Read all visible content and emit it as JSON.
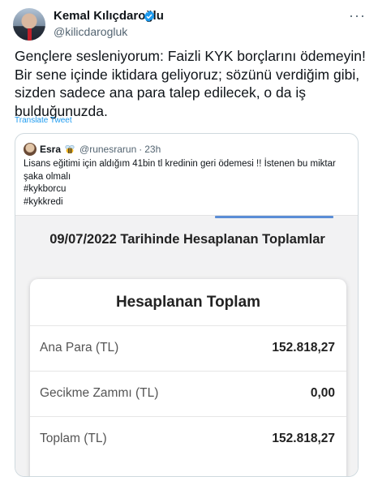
{
  "tweet": {
    "author_name": "Kemal Kılıçdaroğlu",
    "author_handle": "@kilicdarogluk",
    "text": "Gençlere sesleniyorum: Faizli KYK borçlarını ödemeyin! Bir sene içinde iktidara geliyoruz; sözünü verdiğim gibi, sizden sadece ana para talep edilecek, o da iş bulduğunuzda.",
    "translate_label": "Translate Tweet",
    "more_icon": "more-horizontal-icon",
    "verified_icon": "verified-badge-icon",
    "colors": {
      "link": "#1d9bf0",
      "verified": "#1d9bf0",
      "secondary_text": "#536471"
    }
  },
  "quote": {
    "author_name": "Esra",
    "emoji_icon": "bee-icon",
    "author_handle": "@runesrarun",
    "time": "23h",
    "lines": [
      "Lisans eğitimi için aldığım 41bin tl kredinin geri ödemesi !! İstenen bu miktar şaka olmalı",
      "#kykborcu",
      "#kykkredi"
    ]
  },
  "media": {
    "title": "09/07/2022 Tarihinde Hesaplanan Toplamlar",
    "card_title": "Hesaplanan Toplam",
    "rows": [
      {
        "label": "Ana Para (TL)",
        "value": "152.818,27"
      },
      {
        "label": "Gecikme Zammı (TL)",
        "value": "0,00"
      },
      {
        "label": "Toplam (TL)",
        "value": "152.818,27"
      }
    ]
  }
}
